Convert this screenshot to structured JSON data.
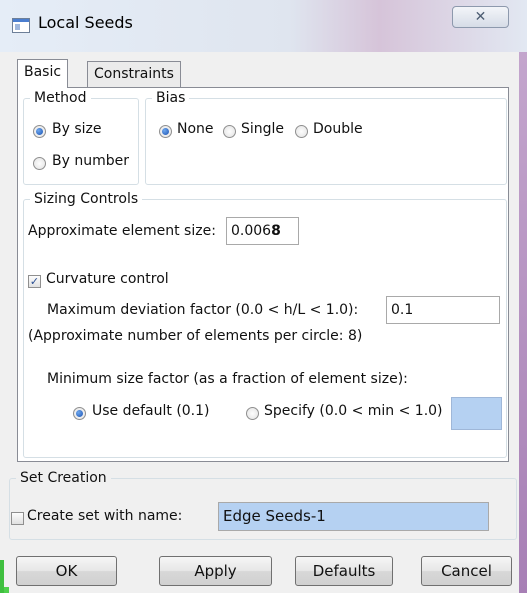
{
  "window": {
    "title": "Local Seeds",
    "close_glyph": "✕"
  },
  "tabs": [
    {
      "label": "Basic"
    },
    {
      "label": "Constraints"
    }
  ],
  "method": {
    "label": "Method",
    "options": [
      {
        "label": "By size",
        "selected": true
      },
      {
        "label": "By number",
        "selected": false
      }
    ]
  },
  "bias": {
    "label": "Bias",
    "options": [
      {
        "label": "None",
        "selected": true
      },
      {
        "label": "Single",
        "selected": false
      },
      {
        "label": "Double",
        "selected": false
      }
    ]
  },
  "sizing": {
    "label": "Sizing Controls",
    "approx_label": "Approximate element size:",
    "approx_value_prefix": "0.006",
    "approx_value_bold": "8",
    "curvature_label": "Curvature control",
    "curvature_checked": true,
    "max_dev_label": "Maximum deviation factor (0.0 < h/L < 1.0):",
    "max_dev_value": "0.1",
    "approx_count_note": "(Approximate number of elements per circle: 8)",
    "min_size_label": "Minimum size factor (as a fraction of element size):",
    "use_default_label": "Use default (0.1)",
    "specify_label": "Specify (0.0 < min < 1.0)",
    "specify_value": ""
  },
  "set_creation": {
    "label": "Set Creation",
    "create_label": "Create set with name:",
    "create_checked": false,
    "name_value": "Edge Seeds-1"
  },
  "buttons": {
    "ok": "OK",
    "apply": "Apply",
    "defaults": "Defaults",
    "cancel": "Cancel"
  },
  "colors": {
    "selection_blue": "#b5d1f2",
    "radio_dot": "#1a52b3"
  }
}
